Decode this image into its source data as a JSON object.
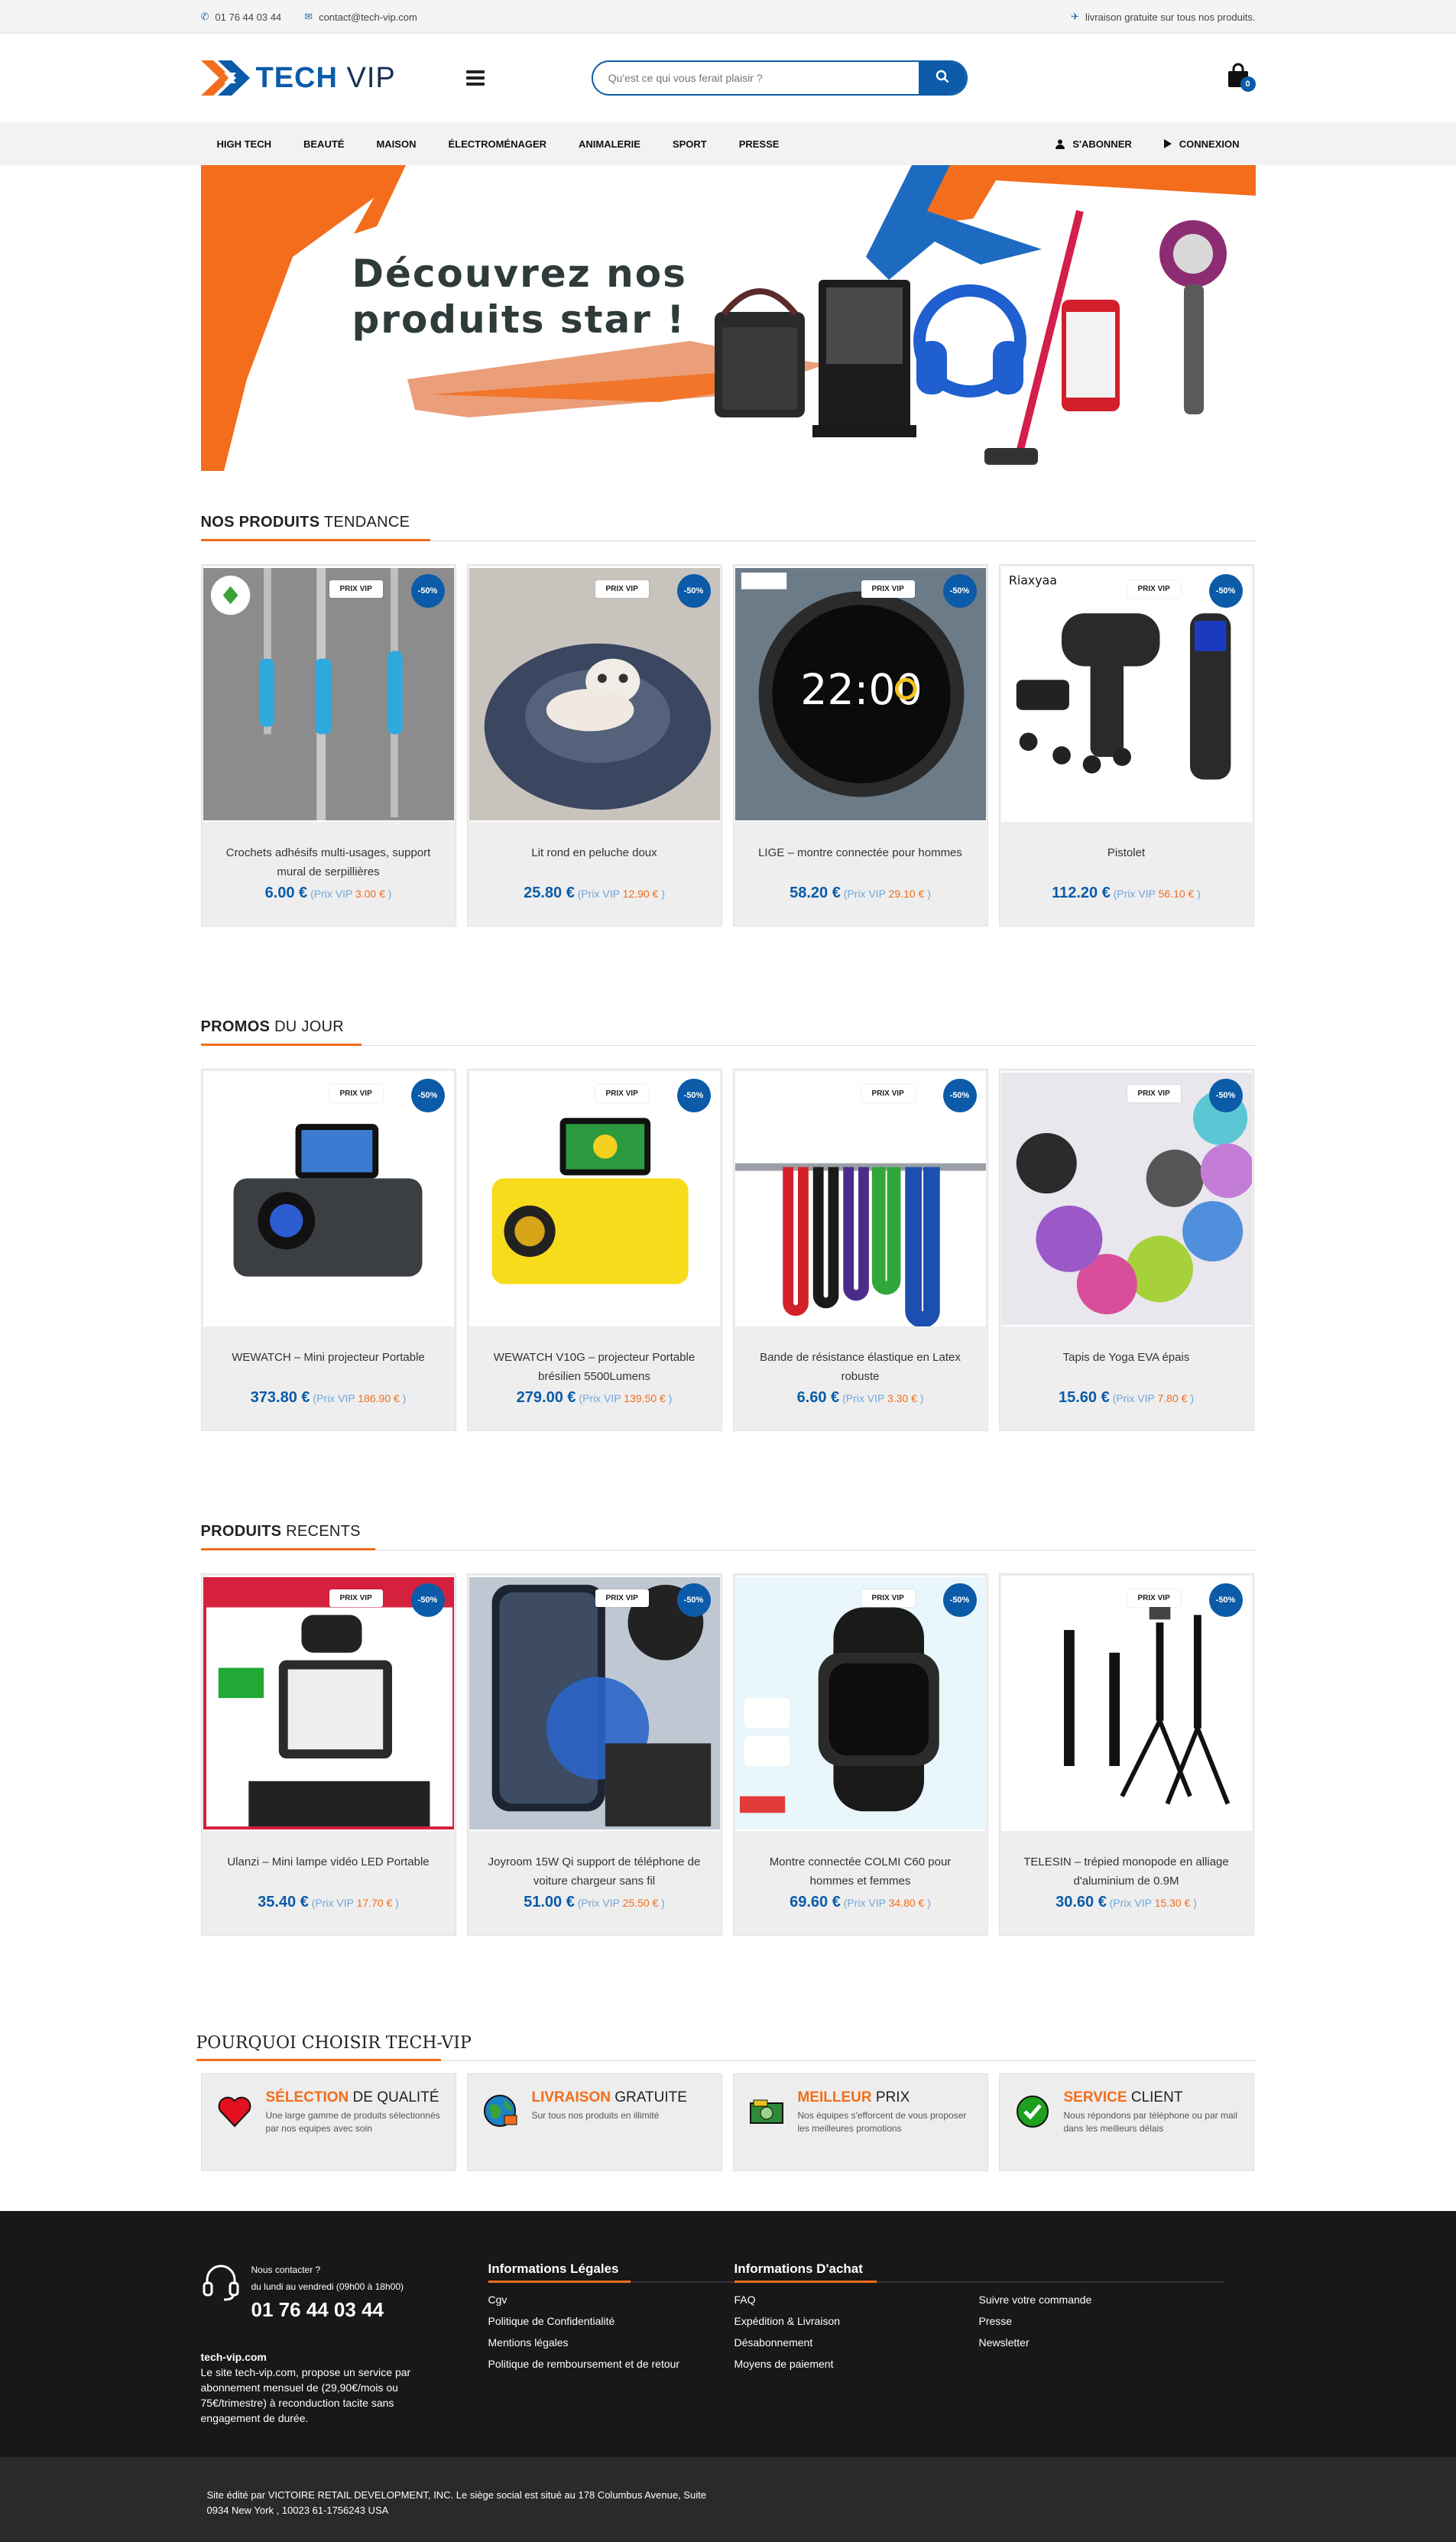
{
  "topbar": {
    "phone": "01 76 44 03 44",
    "email": "contact@tech-vip.com",
    "shipping": "livraison gratuite sur tous nos produits."
  },
  "header": {
    "logo_tech": "TECH",
    "logo_vip": "VIP",
    "search_placeholder": "Qu'est ce qui vous ferait plaisir ?",
    "cart_count": "0"
  },
  "nav": {
    "items": [
      "HIGH TECH",
      "BEAUTÉ",
      "MAISON",
      "ÉLECTROMÉNAGER",
      "ANIMALERIE",
      "SPORT",
      "PRESSE"
    ],
    "subscribe": "S'ABONNER",
    "login": "CONNEXION"
  },
  "banner": {
    "line1": "Découvrez nos",
    "line2": "produits star !"
  },
  "labels": {
    "tag": "PRIX VIP",
    "discount": "-50%",
    "prix_vip": "(Prix VIP",
    "close": ")"
  },
  "sections": [
    {
      "title_bold": "NOS PRODUITS",
      "title_rest": "TENDANCE",
      "products": [
        {
          "name": "Crochets adhésifs multi-usages, support mural de serpillières",
          "price": "6.00 €",
          "vip": "3.00 €"
        },
        {
          "name": "Lit rond en peluche doux",
          "price": "25.80 €",
          "vip": "12.90 €"
        },
        {
          "name": "LIGE – montre connectée pour hommes",
          "price": "58.20 €",
          "vip": "29.10 €"
        },
        {
          "name": "Pistolet",
          "price": "112.20 €",
          "vip": "56.10 €"
        }
      ]
    },
    {
      "title_bold": "PROMOS",
      "title_rest": "DU JOUR",
      "products": [
        {
          "name": "WEWATCH – Mini projecteur Portable",
          "price": "373.80 €",
          "vip": "186.90 €"
        },
        {
          "name": "WEWATCH V10G – projecteur Portable brésilien 5500Lumens",
          "price": "279.00 €",
          "vip": "139.50 €"
        },
        {
          "name": "Bande de résistance élastique en Latex robuste",
          "price": "6.60 €",
          "vip": "3.30 €"
        },
        {
          "name": "Tapis de Yoga EVA épais",
          "price": "15.60 €",
          "vip": "7.80 €"
        }
      ]
    },
    {
      "title_bold": "PRODUITS",
      "title_rest": "RECENTS",
      "products": [
        {
          "name": "Ulanzi – Mini lampe vidéo LED Portable",
          "price": "35.40 €",
          "vip": "17.70 €"
        },
        {
          "name": "Joyroom 15W Qi support de téléphone de voiture chargeur sans fil",
          "price": "51.00 €",
          "vip": "25.50 €"
        },
        {
          "name": "Montre connectée COLMI C60 pour hommes et femmes",
          "price": "69.60 €",
          "vip": "34.80 €"
        },
        {
          "name": "TELESIN – trépied monopode en alliage d'aluminium de 0.9M",
          "price": "30.60 €",
          "vip": "15.30 €"
        }
      ]
    }
  ],
  "why": {
    "title": "POURQUOI CHOISIR TECH-VIP",
    "items": [
      {
        "bold": "SÉLECTION",
        "rest": "DE QUALITÉ",
        "text": "Une large gamme de produits sélectionnés par nos equipes avec soin"
      },
      {
        "bold": "LIVRAISON",
        "rest": "GRATUITE",
        "text": "Sur tous nos produits en illimité"
      },
      {
        "bold": "MEILLEUR",
        "rest": "PRIX",
        "text": "Nos équipes s'efforcent de vous proposer les meilleures promotions"
      },
      {
        "bold": "SERVICE",
        "rest": "CLIENT",
        "text": "Nous répondons par téléphone ou par mail dans les meilleurs délais"
      }
    ]
  },
  "footer": {
    "contact_q": "Nous contacter ?",
    "contact_hours": "du lundi au vendredi (09h00 à 18h00)",
    "contact_phone": "01 76 44 03 44",
    "site": "tech-vip.com",
    "about": "Le site tech-vip.com, propose un service par abonnement mensuel de (29,90€/mois ou 75€/trimestre) à reconduction tacite sans engagement de durée.",
    "legal_title": "Informations Légales",
    "legal_links": [
      "Cgv",
      "Politique de Confidentialité",
      "Mentions légales",
      "Politique de remboursement et de retour"
    ],
    "buy_title": "Informations D'achat",
    "buy_col1": [
      "FAQ",
      "Expédition & Livraison",
      "Désabonnement",
      "Moyens de paiement"
    ],
    "buy_col2": [
      "Suivre votre commande",
      "Presse",
      "Newsletter"
    ],
    "bottom": "Site édité par VICTOIRE RETAIL DEVELOPMENT, INC. Le siège social est situé au 178 Columbus Avenue, Suite 0934 New York , 10023 61-1756243 USA"
  },
  "colors": {
    "brand_blue": "#0b5ba8",
    "accent_orange": "#f36d1c"
  }
}
